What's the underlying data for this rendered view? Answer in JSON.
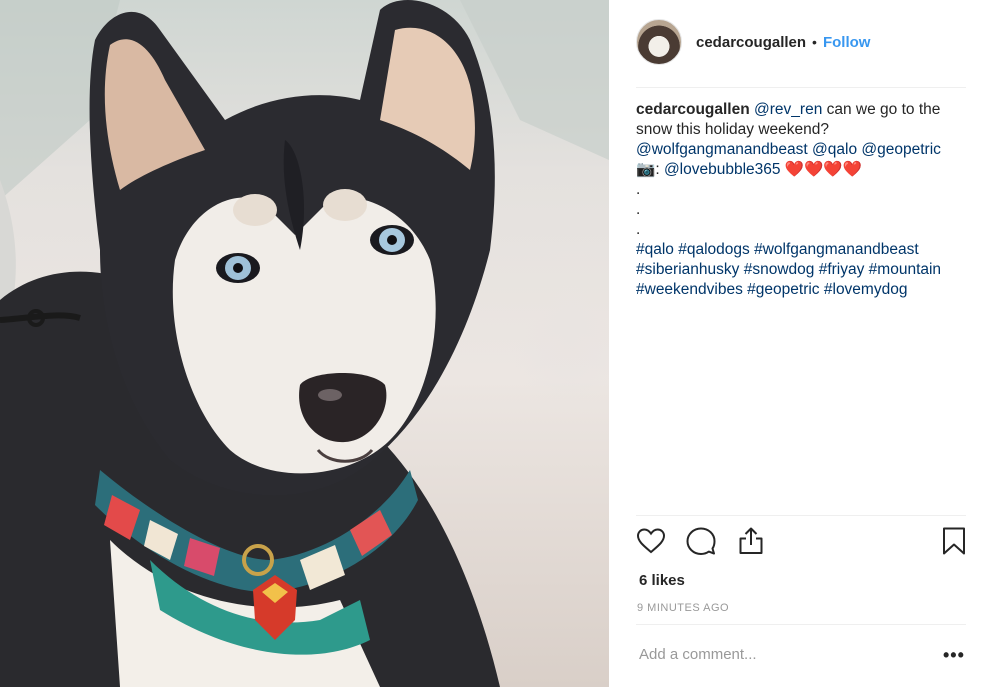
{
  "photo": {
    "subject": "siberian husky with blue eyes wearing a colorful patterned collar in snow"
  },
  "post": {
    "avatar_icon": "profile-avatar-husky",
    "username": "cedarcougallen",
    "follow_label": "Follow",
    "caption": {
      "username": "cedarcougallen",
      "mention_rev_ren": "@rev_ren",
      "text1": " can we go to the",
      "text2": "snow this holiday weekend?",
      "mention_wolfgang": "@wolfgangmanandbeast",
      "mention_qalo": "@qalo",
      "mention_geopetric": "@geopetric",
      "camera_emoji": "📷",
      "colon": ":",
      "mention_lovebubble": "@lovebubble365",
      "hearts": "❤️❤️❤️❤️",
      "dot": ".",
      "hashtags_line1": [
        "#qalo",
        "#qalodogs",
        "#wolfgangmanandbeast"
      ],
      "hashtags_line2": [
        "#siberianhusky",
        "#snowdog",
        "#friyay",
        "#mountain"
      ],
      "hashtags_line3": [
        "#weekendvibes",
        "#geopetric",
        "#lovemydog"
      ]
    },
    "likes": "6 likes",
    "timestamp": "9 MINUTES AGO",
    "comment_placeholder": "Add a comment...",
    "more_options": "•••"
  },
  "colors": {
    "link": "#003569",
    "follow": "#3897f0",
    "muted": "#999999",
    "heart": "#ed4956"
  }
}
